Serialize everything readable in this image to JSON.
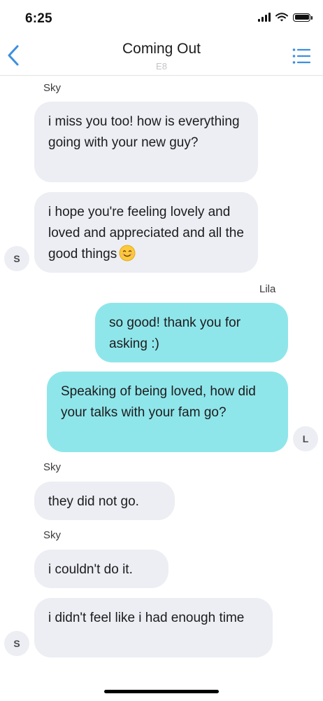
{
  "status": {
    "time": "6:25"
  },
  "header": {
    "title": "Coming Out",
    "subtitle": "E8"
  },
  "messages": [
    {
      "sender": "Sky",
      "text": "i miss you too! how is everything going with your new guy?"
    },
    {
      "text": "i hope you're feeling lovely and loved and appreciated and all the good things",
      "emoji": "smiling-face-emoji",
      "avatar": "S"
    },
    {
      "sender": "Lila",
      "text": "so good! thank you for asking :)"
    },
    {
      "text": "Speaking of being loved, how did your talks with your fam go?",
      "avatar": "L"
    },
    {
      "sender": "Sky",
      "text": "they did not go."
    },
    {
      "sender": "Sky",
      "text": "i couldn't do it."
    },
    {
      "text": "i didn't feel like i had enough time",
      "avatar": "S"
    }
  ],
  "colors": {
    "accent": "#3d8fe0",
    "outgoing_bubble": "#8fe6ea",
    "incoming_bubble": "#eceef3"
  }
}
